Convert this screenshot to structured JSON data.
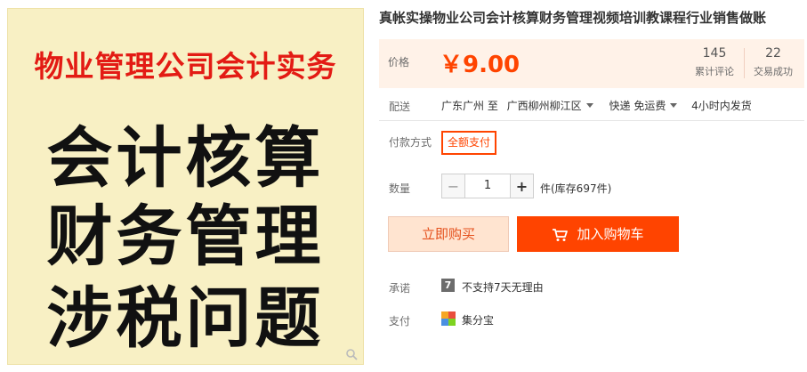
{
  "image": {
    "headline": "物业管理公司会计实务",
    "lines": [
      "会计核算",
      "财务管理",
      "涉税问题"
    ]
  },
  "title": "真帐实操物业公司会计核算财务管理视频培训教课程行业销售做账",
  "price": {
    "label": "价格",
    "value": "￥9.00"
  },
  "stats": {
    "reviews": {
      "count": "145",
      "label": "累计评论"
    },
    "sales": {
      "count": "22",
      "label": "交易成功"
    }
  },
  "shipping": {
    "label": "配送",
    "from": "广东广州 至",
    "to": "广西柳州柳江区",
    "method": "快递 免运费",
    "dispatch": "4小时内发货"
  },
  "payment_method": {
    "label": "付款方式",
    "selected": "全额支付"
  },
  "quantity": {
    "label": "数量",
    "value": "1",
    "minus": "−",
    "plus": "+",
    "stock": "件(库存697件)"
  },
  "actions": {
    "buy_now": "立即购买",
    "add_to_cart": "加入购物车"
  },
  "promise": {
    "label": "承诺",
    "icon_text": "7",
    "text": "不支持7天无理由"
  },
  "pay": {
    "label": "支付",
    "text": "集分宝"
  },
  "colors": {
    "accent": "#ff4400",
    "price_bg": "#fff2e8",
    "image_bg": "#f8f0c4",
    "headline_red": "#e31b14"
  }
}
